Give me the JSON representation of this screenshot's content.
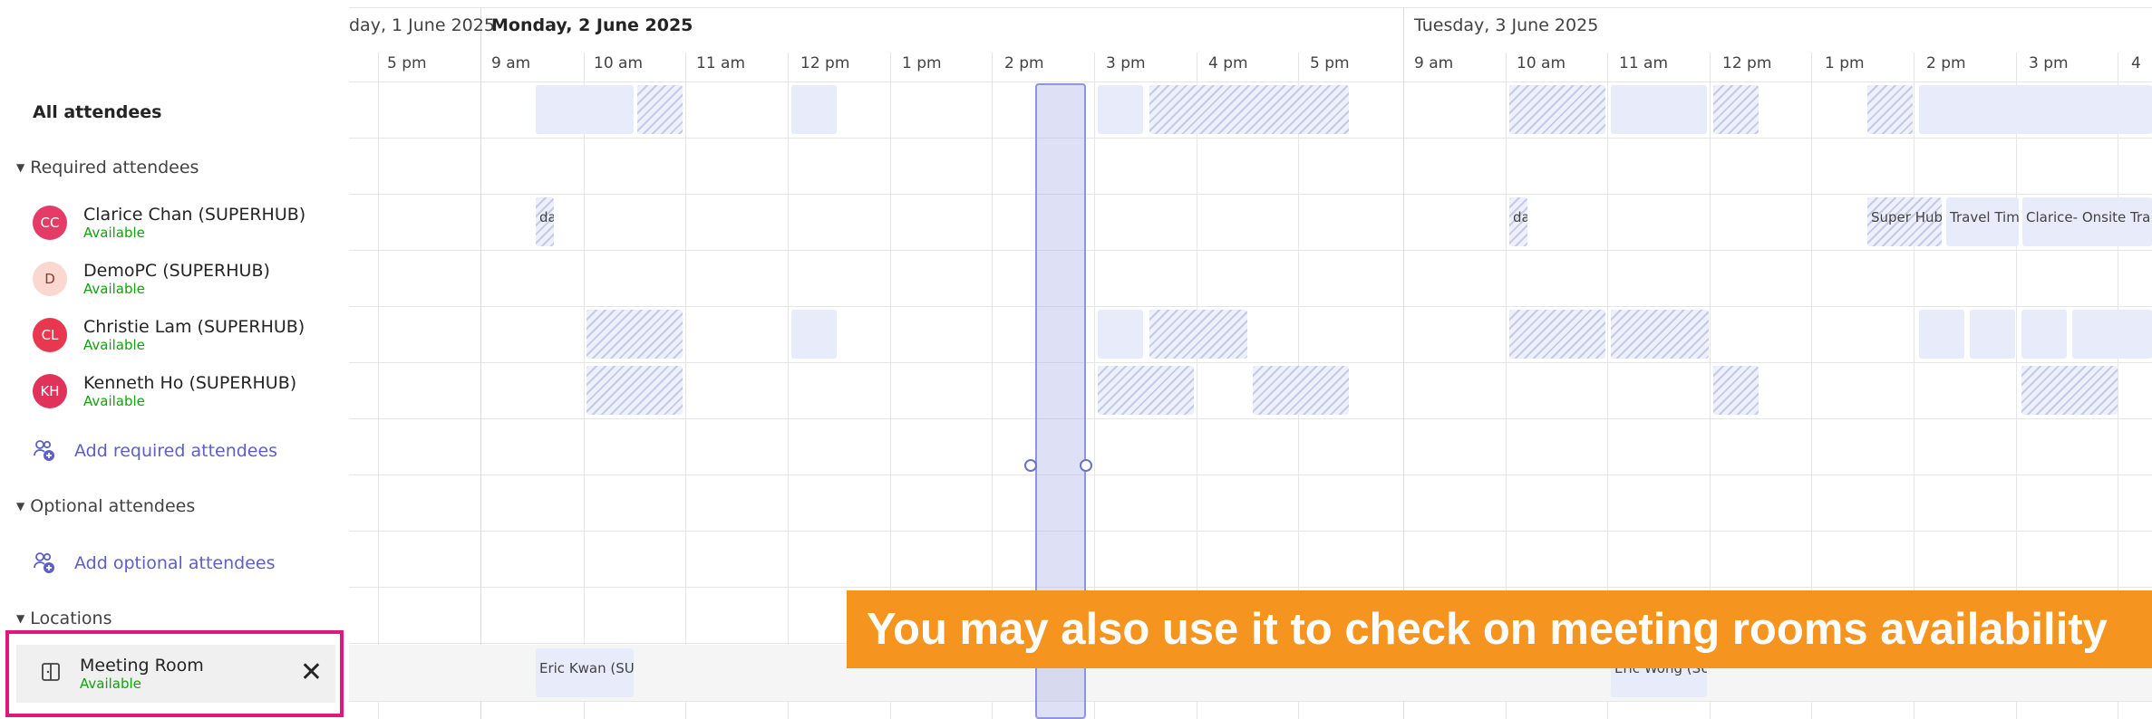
{
  "sidebar": {
    "all_attendees": "All attendees",
    "required_section": "Required attendees",
    "attendees": [
      {
        "initials": "CC",
        "name": "Clarice Chan (SUPERHUB)",
        "status": "Available",
        "color": "#e43c67"
      },
      {
        "initials": "D",
        "name": "DemoPC (SUPERHUB)",
        "status": "Available",
        "color": "#fad8d0"
      },
      {
        "initials": "CL",
        "name": "Christie Lam (SUPERHUB)",
        "status": "Available",
        "color": "#e8384f"
      },
      {
        "initials": "KH",
        "name": "Kenneth Ho (SUPERHUB)",
        "status": "Available",
        "color": "#e0325a"
      }
    ],
    "add_required": "Add required attendees",
    "optional_section": "Optional attendees",
    "add_optional": "Add optional attendees",
    "locations_section": "Locations",
    "location": {
      "name": "Meeting Room",
      "status": "Available"
    }
  },
  "days": [
    {
      "label": "day, 1 June 2025",
      "bold": false
    },
    {
      "label": "Monday, 2 June 2025",
      "bold": true
    },
    {
      "label": "Tuesday, 3 June 2025",
      "bold": false
    }
  ],
  "hours": [
    "5 pm",
    "9 am",
    "10 am",
    "11 am",
    "12 pm",
    "1 pm",
    "2 pm",
    "3 pm",
    "4 pm",
    "5 pm",
    "9 am",
    "10 am",
    "11 am",
    "12 pm",
    "1 pm",
    "2 pm",
    "3 pm",
    "4"
  ],
  "events": {
    "clarice_1": "da",
    "clarice_2": "da",
    "clarice_3": "Super Hub",
    "clarice_4": "Travel Tim",
    "clarice_5": "Clarice- Onsite Tra",
    "room_1": "Eric Kwan (SU",
    "room_2": "Eric Wong (SU"
  },
  "banner": "You may also use it to check on meeting rooms availability",
  "colors": {
    "accent": "#5b5fc7",
    "available": "#13a10e",
    "busy_block": "#e8ebfa",
    "highlight": "#e0177d",
    "banner": "#f5941e"
  }
}
